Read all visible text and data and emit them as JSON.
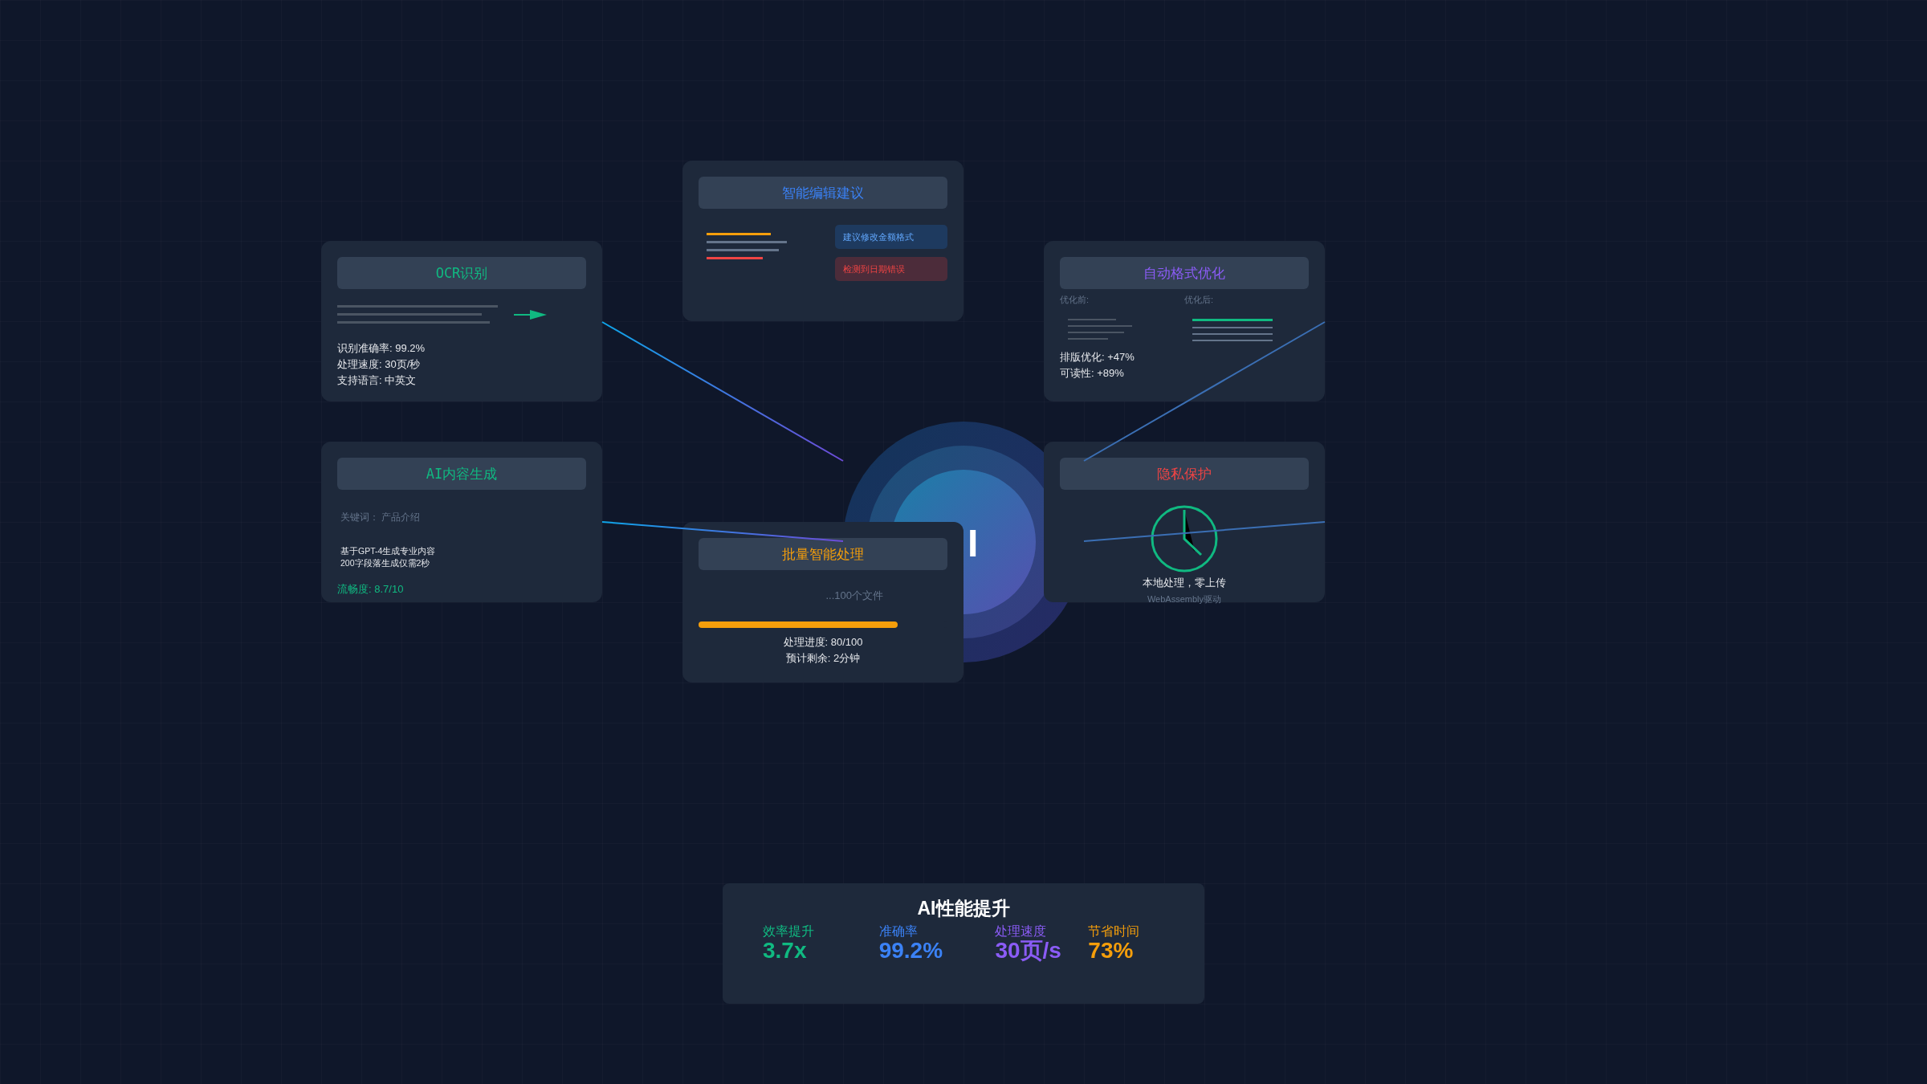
{
  "hub": {
    "label": "I"
  },
  "nodes": [
    {
      "kind": "ocr",
      "title": "OCR识别",
      "color": "#10b981",
      "stats": [
        "识别准确率: 99.2%",
        "处理速度: 30页/秒",
        "支持语言: 中英文"
      ]
    },
    {
      "kind": "edit",
      "title": "智能编辑建议",
      "color": "#3b82f6",
      "suggestions": [
        {
          "kind": "info",
          "text": "建议修改金额格式"
        },
        {
          "kind": "error",
          "text": "检测到日期错误"
        }
      ]
    },
    {
      "kind": "format",
      "title": "自动格式优化",
      "color": "#8b5cf6",
      "before_label": "优化前:",
      "after_label": "优化后:",
      "stats": [
        "排版优化: +47%",
        "可读性: +89%"
      ]
    },
    {
      "kind": "content",
      "title": "AI内容生成",
      "color": "#10b981",
      "keyword": "关键词： 产品介绍",
      "description": [
        "基于GPT-4生成专业内容",
        "200字段落生成仅需2秒"
      ],
      "score": "流畅度: 8.7/10"
    },
    {
      "kind": "batch",
      "title": "批量智能处理",
      "color": "#f59e0b",
      "files": "...100个文件",
      "level": 0.8,
      "stats": [
        "处理进度: 80/100",
        "预计剩余: 2分钟"
      ]
    },
    {
      "kind": "privacy",
      "title": "隐私保护",
      "color": "#ef4444",
      "caption": "本地处理，零上传",
      "subcaption": "WebAssembly驱动"
    }
  ],
  "summary": {
    "title": "AI性能提升",
    "metrics": [
      {
        "label": "效率提升",
        "value": "3.7x",
        "color": "#10b981"
      },
      {
        "label": "准确率",
        "value": "99.2%",
        "color": "#3b82f6"
      },
      {
        "label": "处理速度",
        "value": "30页/s",
        "color": "#8b5cf6"
      },
      {
        "label": "节省时间",
        "value": "73%",
        "color": "#f59e0b"
      }
    ]
  }
}
